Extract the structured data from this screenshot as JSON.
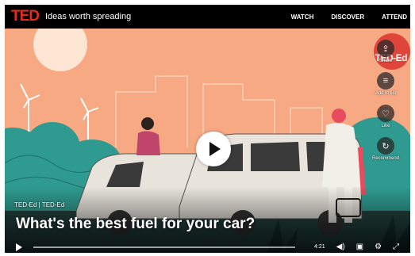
{
  "header": {
    "logo": "TED",
    "tagline": "Ideas worth spreading",
    "nav": [
      "WATCH",
      "DISCOVER",
      "ATTEND"
    ]
  },
  "video": {
    "channel": "TED-Ed | TED-Ed",
    "title": "What's the best fuel for your car?",
    "duration": "4:21",
    "watermark": "TED-Ed"
  },
  "actions": [
    {
      "label": "Share",
      "icon": "share-icon"
    },
    {
      "label": "Add to list",
      "icon": "add-to-list-icon"
    },
    {
      "label": "Like",
      "icon": "heart-icon"
    },
    {
      "label": "Recommend",
      "icon": "recommend-icon"
    }
  ],
  "controls": {
    "icons": [
      "play-icon",
      "volume-icon",
      "captions-icon",
      "settings-icon",
      "fullscreen-icon"
    ]
  },
  "colors": {
    "ted_red": "#e62b1e",
    "sky": "#f7a983",
    "teal": "#2f9a8f",
    "car": "#e8e4dc"
  }
}
